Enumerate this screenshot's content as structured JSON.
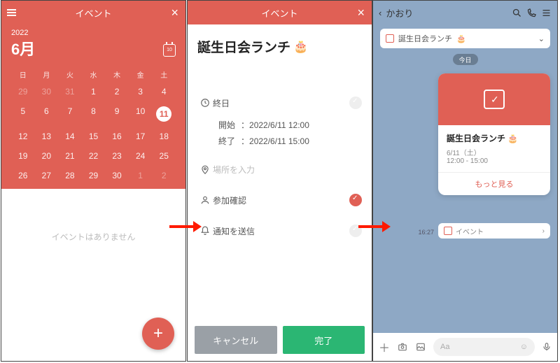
{
  "s1": {
    "header_title": "イベント",
    "year": "2022",
    "month": "6月",
    "today_badge": "10",
    "dow": [
      "日",
      "月",
      "火",
      "水",
      "木",
      "金",
      "土"
    ],
    "days": [
      {
        "n": "29",
        "dim": true
      },
      {
        "n": "30",
        "dim": true
      },
      {
        "n": "31",
        "dim": true
      },
      {
        "n": "1"
      },
      {
        "n": "2"
      },
      {
        "n": "3"
      },
      {
        "n": "4"
      },
      {
        "n": "5"
      },
      {
        "n": "6"
      },
      {
        "n": "7"
      },
      {
        "n": "8"
      },
      {
        "n": "9"
      },
      {
        "n": "10"
      },
      {
        "n": "11",
        "sel": true
      },
      {
        "n": "12"
      },
      {
        "n": "13"
      },
      {
        "n": "14"
      },
      {
        "n": "15"
      },
      {
        "n": "16"
      },
      {
        "n": "17"
      },
      {
        "n": "18"
      },
      {
        "n": "19"
      },
      {
        "n": "20"
      },
      {
        "n": "21"
      },
      {
        "n": "22"
      },
      {
        "n": "23"
      },
      {
        "n": "24"
      },
      {
        "n": "25"
      },
      {
        "n": "26"
      },
      {
        "n": "27"
      },
      {
        "n": "28"
      },
      {
        "n": "29"
      },
      {
        "n": "30"
      },
      {
        "n": "1",
        "dim": true
      },
      {
        "n": "2",
        "dim": true
      }
    ],
    "empty_text": "イベントはありません",
    "fab": "+"
  },
  "s2": {
    "header_title": "イベント",
    "event_title": "誕生日会ランチ",
    "cake_emoji": "🎂",
    "allday_label": "終日",
    "start_label": "開始",
    "start_value": "2022/6/11 12:00",
    "end_label": "終了",
    "end_value": "2022/6/11 15:00",
    "location_placeholder": "場所を入力",
    "rsvp_label": "参加確認",
    "notify_label": "通知を送信",
    "cancel_label": "キャンセル",
    "ok_label": "完了"
  },
  "s3": {
    "chat_name": "かおり",
    "pill_title": "誕生日会ランチ",
    "pill_emoji": "🎂",
    "day_chip": "今日",
    "card_title": "誕生日会ランチ",
    "card_emoji": "🎂",
    "card_date": "6/11（土）",
    "card_time": "12:00 - 15:00",
    "card_more": "もっと見る",
    "mini_label": "イベント",
    "timestamp": "16:27",
    "input_placeholder": "Aa"
  }
}
